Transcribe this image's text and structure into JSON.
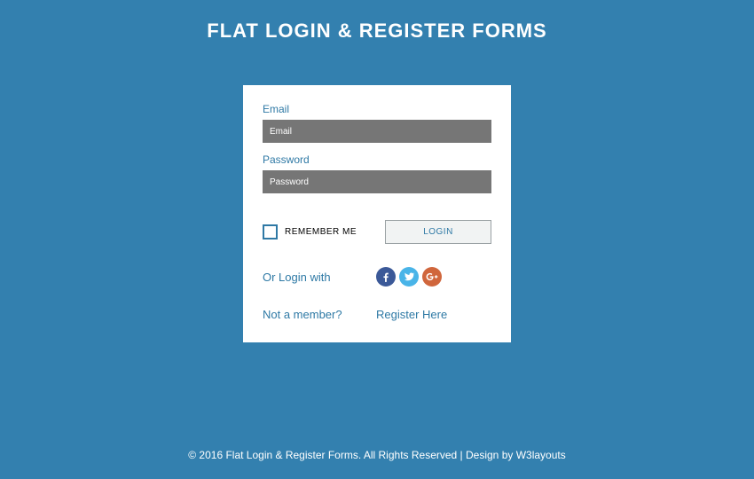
{
  "page": {
    "title": "FLAT LOGIN & REGISTER FORMS"
  },
  "form": {
    "email_label": "Email",
    "email_placeholder": "Email",
    "password_label": "Password",
    "password_placeholder": "Password",
    "remember_label": "REMEMBER ME",
    "login_button": "LOGIN",
    "social_label": "Or Login with",
    "not_member": "Not a member?",
    "register_link": "Register Here"
  },
  "footer": {
    "copy": "© 2016 Flat Login & Register Forms. All Rights Reserved | Design by ",
    "w3": "W3layouts"
  },
  "colors": {
    "bg": "#3380af",
    "accent": "#2f79a5",
    "input_bg": "#767676"
  }
}
